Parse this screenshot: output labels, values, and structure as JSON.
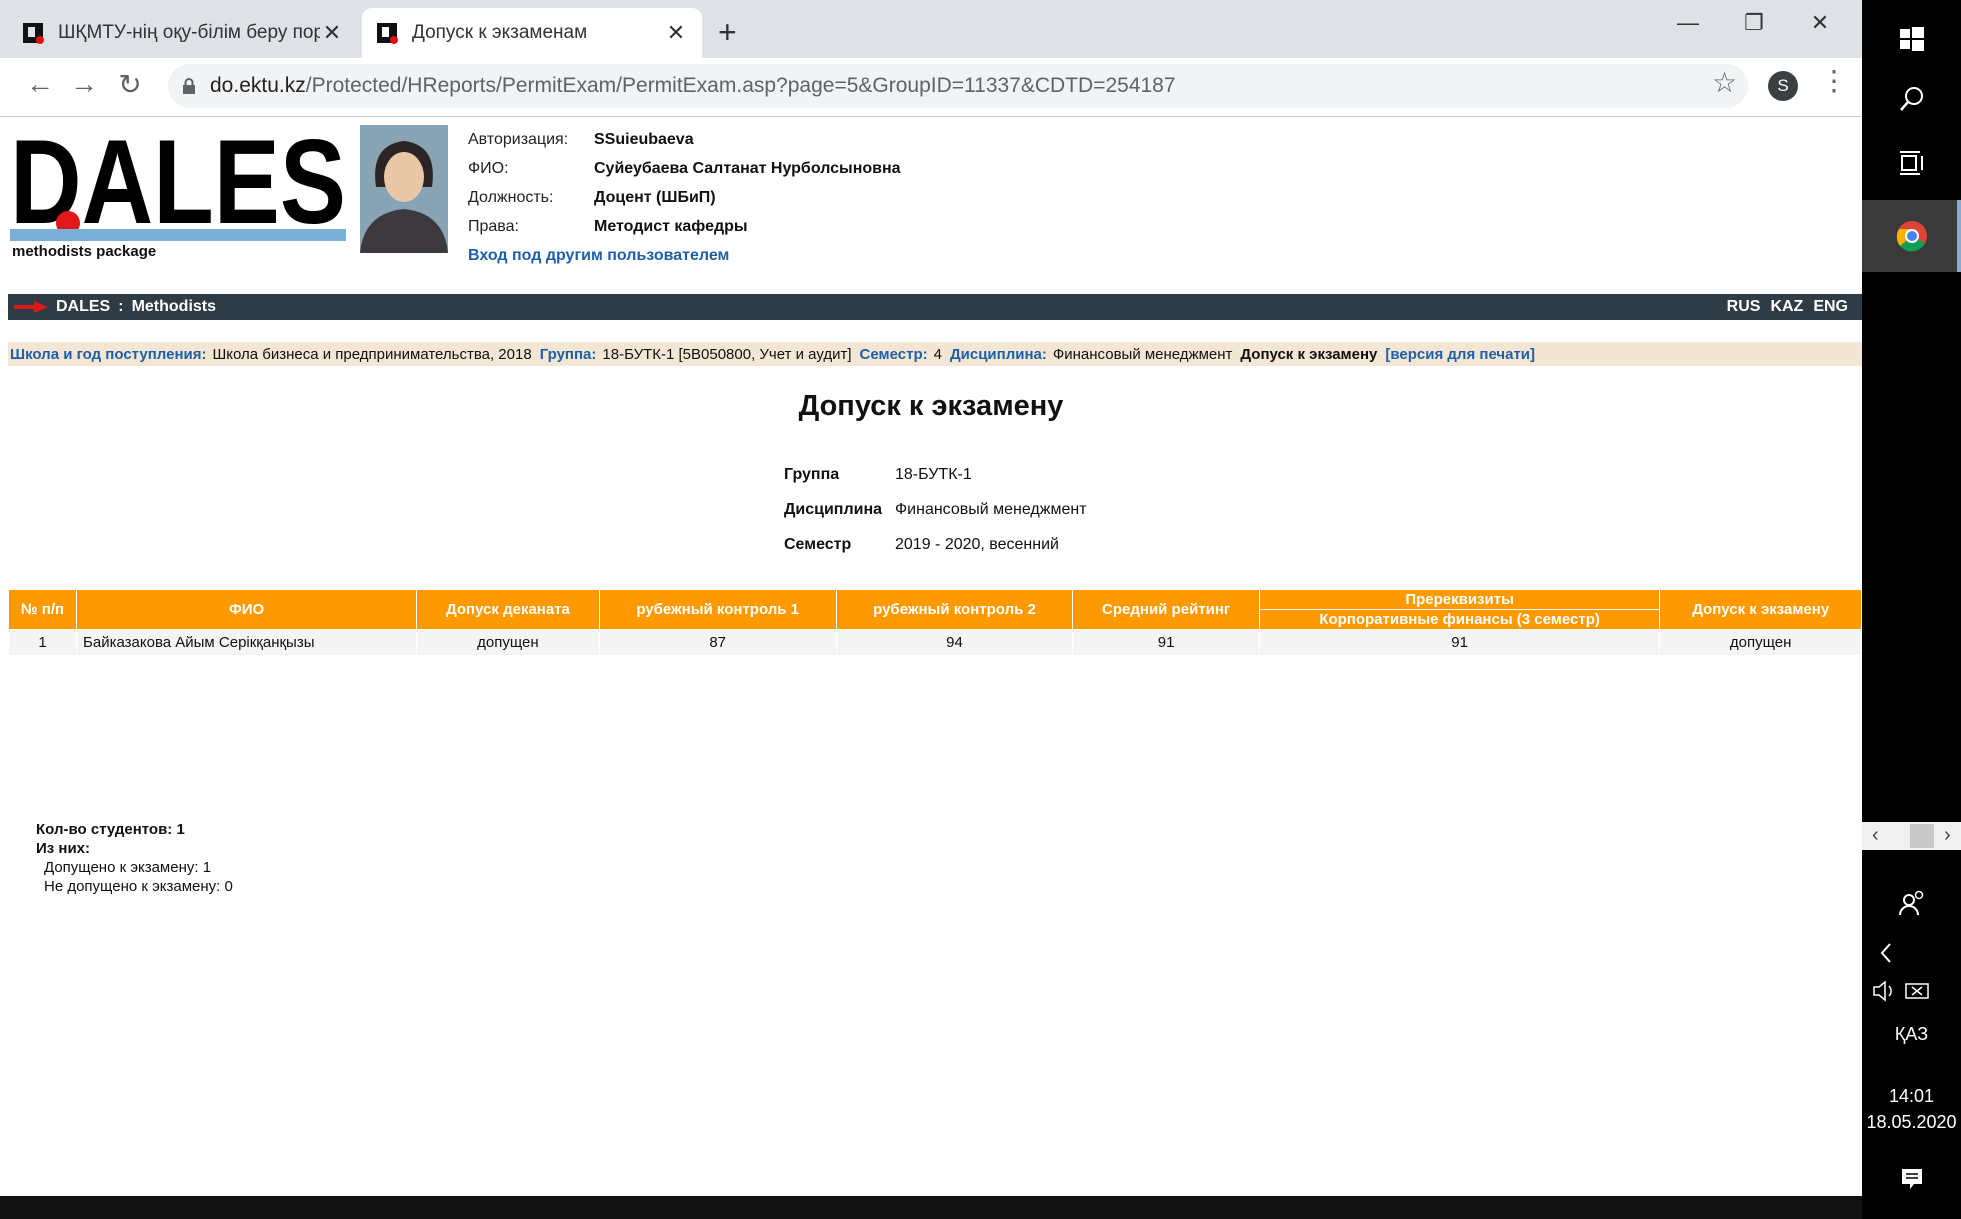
{
  "browser": {
    "tabs": [
      {
        "title": "ШҚМТУ-нің оқу-білім беру пор",
        "close": "✕"
      },
      {
        "title": "Допуск к экзаменам",
        "close": "✕"
      }
    ],
    "new_tab": "+",
    "window_controls": {
      "minimize": "—",
      "maximize": "❐",
      "close": "✕"
    },
    "nav": {
      "back": "←",
      "forward": "→",
      "reload": "↻"
    },
    "url_host": "do.ektu.kz",
    "url_path": "/Protected/HReports/PermitExam/PermitExam.asp?page=5&GroupID=11337&CDTD=254187",
    "bookmark_icon": "☆",
    "profile_initial": "S",
    "menu_icon": "⋮"
  },
  "header": {
    "logo_text": "DALES",
    "logo_tagline": "methodists package",
    "auth": {
      "login_label": "Авторизация:",
      "login_value": "SSuieubaeva",
      "name_label": "ФИО:",
      "name_value": "Суйеубаева Салтанат Нурболсыновна",
      "position_label": "Должность:",
      "position_value": "Доцент (ШБиП)",
      "rights_label": "Права:",
      "rights_value": "Методист кафедры",
      "switch_user_link": "Вход под другим пользователем"
    }
  },
  "navbar": {
    "root": "DALES",
    "separator": ":",
    "section": "Methodists",
    "languages": [
      "RUS",
      "KAZ",
      "ENG"
    ]
  },
  "breadcrumbs": {
    "school_key": "Школа и год поступления:",
    "school_value": "Школа бизнеса и предпринимательства, 2018",
    "group_key": "Группа:",
    "group_value": "18-БУТК-1 [5В050800, Учет и аудит]",
    "semester_key": "Семестр:",
    "semester_value": "4",
    "discipline_key": "Дисциплина:",
    "discipline_value": "Финансовый менеджмент",
    "current": "Допуск к экзамену",
    "print_link": "[версия для печати]"
  },
  "main": {
    "title": "Допуск к экзамену",
    "info": {
      "group_label": "Группа",
      "group_value": "18-БУТК-1",
      "discipline_label": "Дисциплина",
      "discipline_value": "Финансовый менеджмент",
      "semester_label": "Семестр",
      "semester_value": "2019 - 2020, весенний"
    },
    "table": {
      "headers": {
        "num": "№ п/п",
        "fio": "ФИО",
        "dean": "Допуск деканата",
        "rk1": "рубежный контроль 1",
        "rk2": "рубежный контроль 2",
        "avg": "Средний рейтинг",
        "prereq": "Пререквизиты",
        "prereq_sub": "Корпоративные финансы (3 семестр)",
        "admission": "Допуск к экзамену"
      },
      "rows": [
        {
          "num": "1",
          "fio": "Байказакова Айым Серікқанқызы",
          "dean": "допущен",
          "rk1": "87",
          "rk2": "94",
          "avg": "91",
          "prereq": "91",
          "admission": "допущен"
        }
      ]
    },
    "stats": {
      "count_label": "Кол-во студентов: 1",
      "of_them": "Из них:",
      "admitted": "Допущено к экзамену: 1",
      "not_admitted": "Не допущено к экзамену: 0"
    }
  },
  "taskbar": {
    "language": "ҚАЗ",
    "time": "14:01",
    "date": "18.05.2020"
  }
}
